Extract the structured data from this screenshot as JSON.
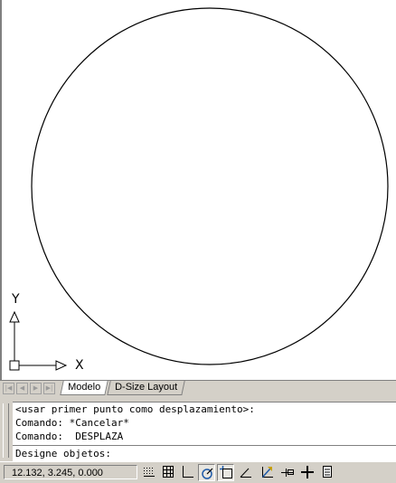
{
  "drawing": {
    "ucs_y_label": "Y",
    "ucs_x_label": "X"
  },
  "tabs": [
    {
      "label": "Modelo",
      "active": true
    },
    {
      "label": "D-Size Layout",
      "active": false
    }
  ],
  "command": {
    "history": [
      "<usar primer punto como desplazamiento>:",
      "Comando: *Cancelar*",
      "Comando:  DESPLAZA"
    ],
    "prompt": "Designe objetos:"
  },
  "status": {
    "coordinates": "12.132, 3.245, 0.000",
    "toggles": [
      {
        "icon": "snap-icon",
        "on": false
      },
      {
        "icon": "grid-icon",
        "on": false
      },
      {
        "icon": "ortho-icon",
        "on": false
      },
      {
        "icon": "polar-icon",
        "on": true
      },
      {
        "icon": "osnap-icon",
        "on": true
      },
      {
        "icon": "otrack-icon",
        "on": false
      },
      {
        "icon": "dynamic-ucs-icon",
        "on": false
      },
      {
        "icon": "dynamic-input-icon",
        "on": false
      },
      {
        "icon": "lineweight-icon",
        "on": false
      },
      {
        "icon": "quick-properties-icon",
        "on": false
      }
    ]
  },
  "colors": {
    "chrome": "#d4d0c8",
    "canvas": "#ffffff",
    "polar_on": "#1e5aa8"
  }
}
